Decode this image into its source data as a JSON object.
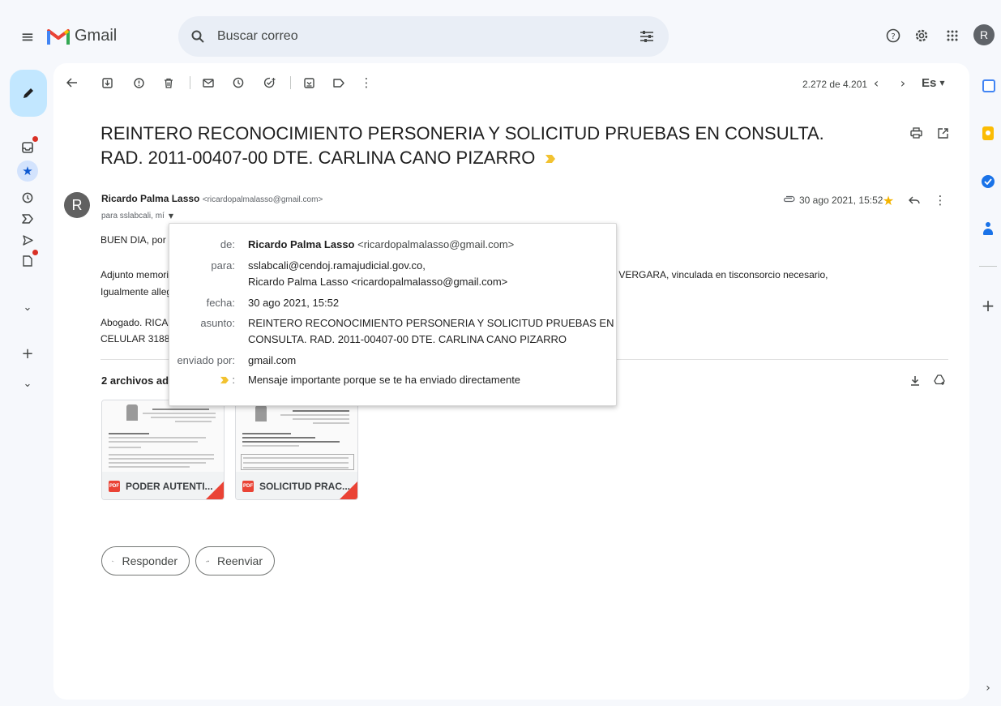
{
  "app": {
    "name": "Gmail",
    "avatar_letter": "R"
  },
  "search": {
    "placeholder": "Buscar correo"
  },
  "toolbar": {
    "counter": "2.272 de 4.201",
    "language": "Es"
  },
  "email": {
    "subject": "REINTERO RECONOCIMIENTO PERSONERIA Y SOLICITUD PRUEBAS EN CONSULTA. RAD. 2011-00407-00 DTE. CARLINA CANO PIZARRO",
    "sender_avatar": "R",
    "sender_name": "Ricardo Palma Lasso",
    "sender_email": "<ricardopalmalasso@gmail.com>",
    "recipient_summary": "para sslabcali, mí",
    "date": "30 ago 2021, 15:52",
    "body": {
      "line1": "BUEN DIA, por fa",
      "line2": "Adjunto memoria",
      "line2_end": ") VERGARA, vinculada en tisconsorcio necesario,",
      "line3": "Igualmente allege",
      "line4": "Abogado. RICAR",
      "line5": "CELULAR 31887"
    }
  },
  "details_popup": {
    "de_label": "de:",
    "de_name": "Ricardo Palma Lasso",
    "de_email": "<ricardopalmalasso@gmail.com>",
    "para_label": "para:",
    "para_line1": "sslabcali@cendoj.ramajudicial.gov.co,",
    "para_line2": "Ricardo Palma Lasso <ricardopalmalasso@gmail.com>",
    "fecha_label": "fecha:",
    "fecha_value": "30 ago 2021, 15:52",
    "asunto_label": "asunto:",
    "asunto_line1": "REINTERO RECONOCIMIENTO PERSONERIA Y SOLICITUD PRUEBAS EN",
    "asunto_line2": "CONSULTA. RAD. 2011-00407-00 DTE. CARLINA CANO PIZARRO",
    "enviado_label": "enviado por:",
    "enviado_value": "gmail.com",
    "importance_label": ":",
    "importance_value": "Mensaje importante porque se te ha enviado directamente"
  },
  "attachments": {
    "header": "2 archivos adju",
    "items": [
      {
        "name": "PODER AUTENTI...",
        "badge": "PDF"
      },
      {
        "name": "SOLICITUD PRAC...",
        "badge": "PDF"
      }
    ]
  },
  "actions": {
    "reply": "Responder",
    "forward": "Reenviar"
  },
  "colors": {
    "accent_blue": "#0b57d0",
    "compose_bg": "#c2e7ff",
    "importance_yellow": "#f2c230",
    "star_yellow": "#f4b400",
    "gmail_red": "#ea4335"
  }
}
